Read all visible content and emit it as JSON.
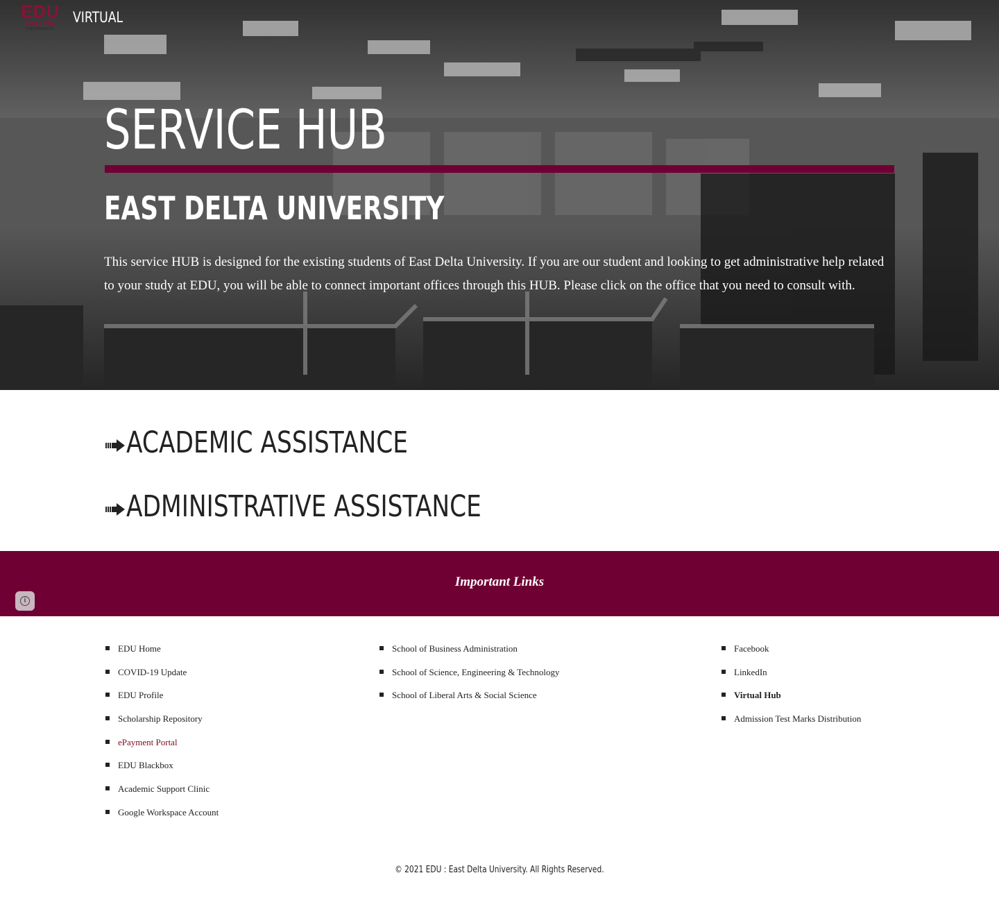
{
  "header": {
    "logo": {
      "text": "EDU",
      "line2": "East Delta",
      "line3": "UNIVERSITY"
    },
    "site_title": "VIRTUAL"
  },
  "hero": {
    "title": "SERVICE HUB",
    "subtitle": "EAST DELTA UNIVERSITY",
    "description": "This service HUB is designed for the existing students of East Delta University. If you are our student and looking to get administrative help related to your study at EDU, you will be able to connect important offices through this HUB. Please click on the office that you need to consult with."
  },
  "sections": [
    {
      "label": "ACADEMIC ASSISTANCE",
      "icon": "arrow-right-icon"
    },
    {
      "label": "ADMINISTRATIVE ASSISTANCE",
      "icon": "arrow-right-icon"
    }
  ],
  "links": {
    "title": "Important Links",
    "column1": [
      "EDU Home",
      "COVID-19 Update",
      "EDU Profile",
      "Scholarship Repository",
      "ePayment Portal",
      "EDU Blackbox",
      "Academic Support Clinic",
      "Google Workspace Account"
    ],
    "column2": [
      "School of Business Administration",
      "School of Science, Engineering & Technology",
      "School of Liberal Arts & Social Science"
    ],
    "column3": [
      "Facebook",
      "LinkedIn",
      "Virtual Hub",
      "Admission Test Marks Distribution"
    ]
  },
  "footer": {
    "copyright": "© 2021 EDU : East Delta University. All Rights Reserved."
  },
  "colors": {
    "brand": "#6f0033",
    "accent_link": "#7a0c1f"
  },
  "icons": {
    "info": "info-icon",
    "bullet": "square-bullet-icon"
  }
}
